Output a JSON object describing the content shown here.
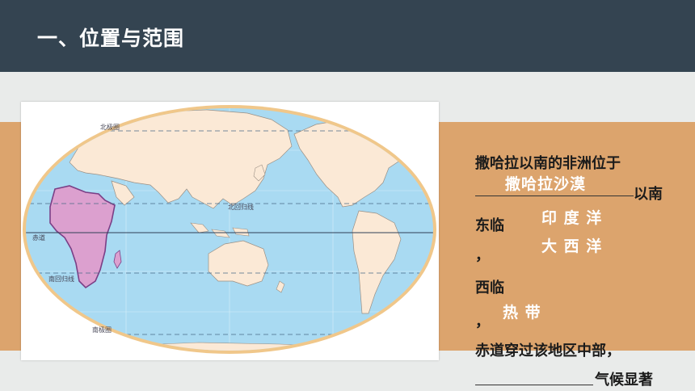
{
  "title": "一、位置与范围",
  "map": {
    "labels": {
      "arctic_circle": "北极圈",
      "tropic_cancer": "北回归线",
      "equator": "赤道",
      "tropic_capricorn": "南回归线",
      "antarctic_circle": "南极圈"
    }
  },
  "text": {
    "line1": "撒哈拉以南的非洲位于",
    "line2_suffix": "以南",
    "east": "东临",
    "comma": "，",
    "west": "西临",
    "equator_line": "赤道穿过该地区中部，",
    "climate_suffix": "气候显著"
  },
  "answers": {
    "sahara": "撒哈拉沙漠",
    "indian_ocean": "印 度 洋",
    "atlantic_ocean": "大 西 洋",
    "tropical": "热 带"
  },
  "colors": {
    "header": "#344451",
    "band": "#dca46d",
    "ocean": "#a9daf2",
    "land": "#fbe9d6",
    "africa": "#dca0cf",
    "africa_border": "#7a3f86"
  }
}
